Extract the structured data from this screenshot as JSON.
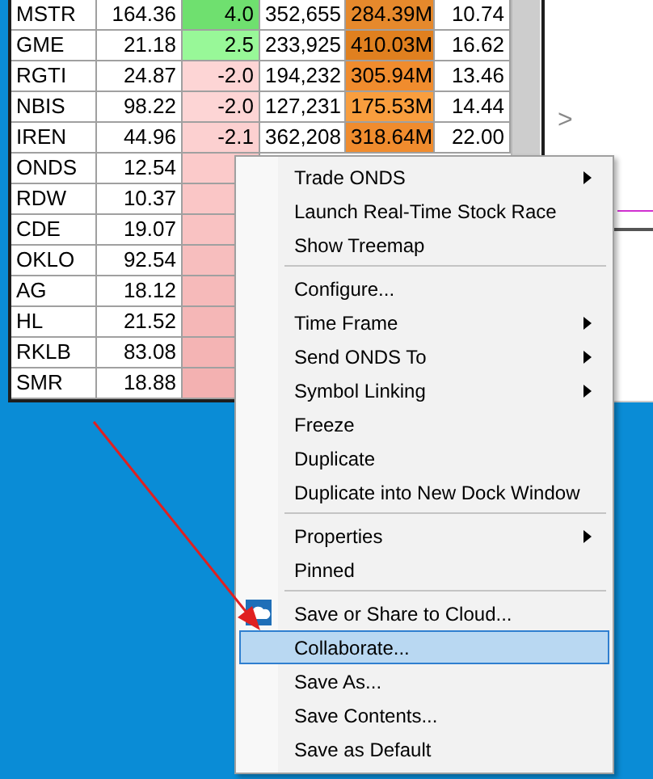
{
  "table": {
    "rows": [
      {
        "symbol": "MSTR",
        "price": "164.36",
        "change": {
          "text": "4.0",
          "color": "#6fe06f"
        },
        "volume": "352,655",
        "value": {
          "text": "284.39M",
          "color": "#e6892c"
        },
        "column_6": "10.74"
      },
      {
        "symbol": "GME",
        "price": "21.18",
        "change": {
          "text": "2.5",
          "color": "#98f898"
        },
        "volume": "233,925",
        "value": {
          "text": "410.03M",
          "color": "#e0801f"
        },
        "column_6": "16.62"
      },
      {
        "symbol": "RGTI",
        "price": "24.87",
        "change": {
          "text": "-2.0",
          "color": "#fdd5d5"
        },
        "volume": "194,232",
        "value": {
          "text": "305.94M",
          "color": "#f08c2e"
        },
        "column_6": "13.46"
      },
      {
        "symbol": "NBIS",
        "price": "98.22",
        "change": {
          "text": "-2.0",
          "color": "#fdd5d5"
        },
        "volume": "127,231",
        "value": {
          "text": "175.53M",
          "color": "#f99e3e"
        },
        "column_6": "14.44"
      },
      {
        "symbol": "IREN",
        "price": "44.96",
        "change": {
          "text": "-2.1",
          "color": "#fcd0d0"
        },
        "volume": "362,208",
        "value": {
          "text": "318.64M",
          "color": "#f08c2e"
        },
        "column_6": "22.00"
      },
      {
        "symbol": "ONDS",
        "price": "12.54",
        "change": {
          "color": "#fbcaca"
        }
      },
      {
        "symbol": "RDW",
        "price": "10.37",
        "change": {
          "color": "#fac6c6"
        }
      },
      {
        "symbol": "CDE",
        "price": "19.07",
        "change": {
          "color": "#f9c2c2"
        }
      },
      {
        "symbol": "OKLO",
        "price": "92.54",
        "change": {
          "color": "#f7bebe"
        }
      },
      {
        "symbol": "AG",
        "price": "18.12",
        "change": {
          "color": "#f6baba"
        }
      },
      {
        "symbol": "HL",
        "price": "21.52",
        "change": {
          "color": "#f5b7b7"
        }
      },
      {
        "symbol": "RKLB",
        "price": "83.08",
        "change": {
          "color": "#f4b4b4"
        }
      },
      {
        "symbol": "SMR",
        "price": "18.88",
        "change": {
          "color": "#f3b1b1"
        }
      }
    ]
  },
  "side_panel": {
    "chevron": ">"
  },
  "context_menu": {
    "items": [
      {
        "kind": "item",
        "label": "Trade ONDS",
        "submenu": true,
        "selected": false
      },
      {
        "kind": "item",
        "label": "Launch Real-Time Stock Race",
        "submenu": false,
        "selected": false
      },
      {
        "kind": "item",
        "label": "Show Treemap",
        "submenu": false,
        "selected": false
      },
      {
        "kind": "separator"
      },
      {
        "kind": "item",
        "label": "Configure...",
        "submenu": false,
        "selected": false
      },
      {
        "kind": "item",
        "label": "Time Frame",
        "submenu": true,
        "selected": false
      },
      {
        "kind": "item",
        "label": "Send ONDS To",
        "submenu": true,
        "selected": false
      },
      {
        "kind": "item",
        "label": "Symbol Linking",
        "submenu": true,
        "selected": false
      },
      {
        "kind": "item",
        "label": "Freeze",
        "submenu": false,
        "selected": false
      },
      {
        "kind": "item",
        "label": "Duplicate",
        "submenu": false,
        "selected": false
      },
      {
        "kind": "item",
        "label": "Duplicate into New Dock Window",
        "submenu": false,
        "selected": false
      },
      {
        "kind": "separator"
      },
      {
        "kind": "item",
        "label": "Properties",
        "submenu": true,
        "selected": false
      },
      {
        "kind": "item",
        "label": "Pinned",
        "submenu": false,
        "selected": false
      },
      {
        "kind": "separator"
      },
      {
        "kind": "icon-item",
        "label": "Save or Share to Cloud...",
        "submenu": false,
        "selected": false
      },
      {
        "kind": "item",
        "label": "Collaborate...",
        "submenu": false,
        "selected": true
      },
      {
        "kind": "item",
        "label": "Save As...",
        "submenu": false,
        "selected": false
      },
      {
        "kind": "item",
        "label": "Save Contents...",
        "submenu": false,
        "selected": false
      },
      {
        "kind": "item",
        "label": "Save as Default",
        "submenu": false,
        "selected": false
      }
    ]
  }
}
